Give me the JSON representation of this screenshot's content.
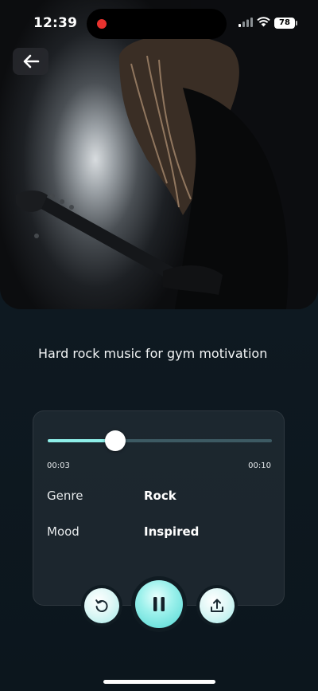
{
  "status_bar": {
    "time": "12:39",
    "battery": "78"
  },
  "song": {
    "title": "Hard rock music for gym motivation"
  },
  "player": {
    "current_time": "00:03",
    "total_time": "00:10",
    "progress": 0.3
  },
  "details": [
    {
      "label": "Genre",
      "value": "Rock"
    },
    {
      "label": "Mood",
      "value": "Inspired"
    }
  ],
  "icons": {
    "back": "arrow-left-icon",
    "replay": "replay-icon",
    "pause": "pause-icon",
    "share": "share-icon",
    "recording": "recording-dot-icon",
    "signal": "cellular-signal-icon",
    "wifi": "wifi-icon",
    "battery": "battery-icon"
  },
  "colors": {
    "accent": "#8ff0ea",
    "background": "#0e1921",
    "recording": "#e8322e"
  }
}
